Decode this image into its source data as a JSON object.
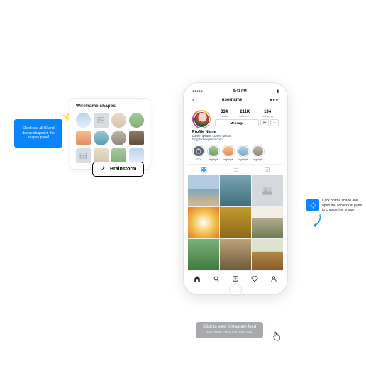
{
  "callout_left": "Check out all UI and device shapes in the shapes panel",
  "wireframe_panel": {
    "title": "Wireframe shapes"
  },
  "brainstorm": {
    "label": "Brainstorm"
  },
  "callout_right": "Click on the shape and open the contextual panel to change the image",
  "tooltip": {
    "line1": "Click to view Instagram feed",
    "line2": "(Hold Shift + ⌘ or Ctrl, then click)"
  },
  "phone": {
    "statusbar": {
      "carrier": "●●●●●",
      "time": "9:41 PM"
    },
    "navbar_title": "username",
    "stats": {
      "posts": {
        "num": "334",
        "label": "posts"
      },
      "followers": {
        "num": "211K",
        "label": "followers"
      },
      "following": {
        "num": "134",
        "label": "following"
      }
    },
    "message_btn": "Message",
    "bio": {
      "name": "Profile Name",
      "text": "Lorem ipsum. Lorem ipsum.",
      "link": "blog.loremipsum.com"
    },
    "highlights": {
      "h0": "IGTV",
      "h1": "highlight",
      "h2": "highlight",
      "h3": "highlight",
      "h4": "highlight"
    }
  }
}
